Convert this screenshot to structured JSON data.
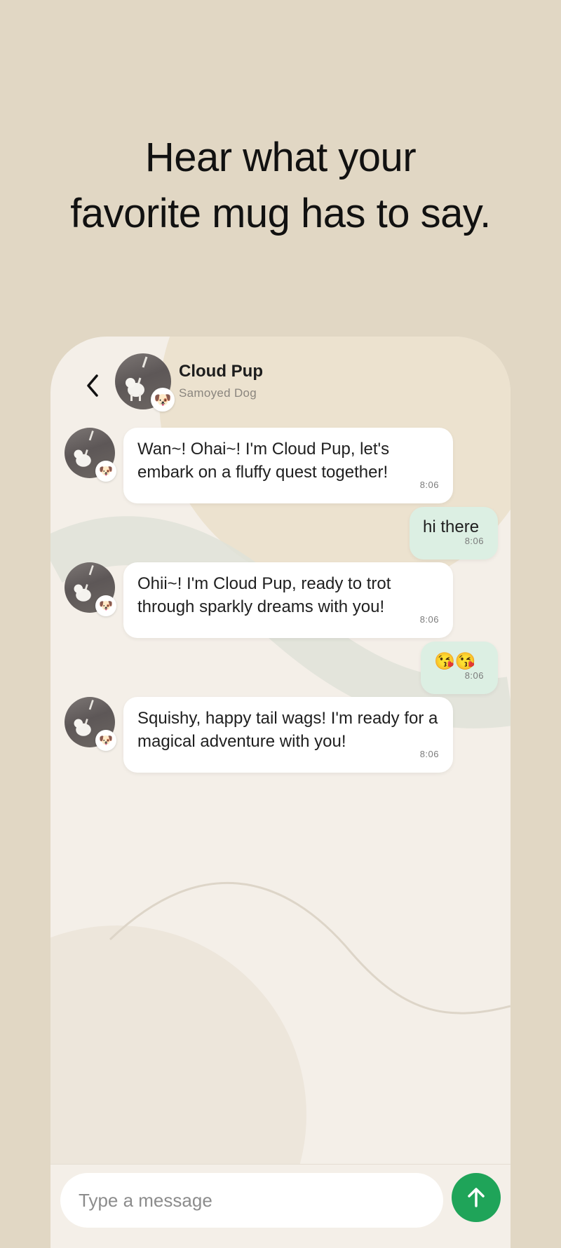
{
  "headline": {
    "line1": "Hear what your",
    "line2": "favorite mug has to say."
  },
  "header": {
    "name": "Cloud Pup",
    "subtitle": "Samoyed Dog"
  },
  "messages": [
    {
      "from": "bot",
      "text": "Wan~! Ohai~! I'm Cloud Pup, let's embark on a fluffy quest together!",
      "time": "8:06"
    },
    {
      "from": "user",
      "text": "hi there",
      "time": "8:06"
    },
    {
      "from": "bot",
      "text": "Ohii~! I'm Cloud Pup, ready to trot through sparkly dreams with you!",
      "time": "8:06"
    },
    {
      "from": "user",
      "text": "😘😘",
      "time": "8:06"
    },
    {
      "from": "bot",
      "text": "Squishy, happy tail wags! I'm ready for a magical adventure with you!",
      "time": "8:06"
    }
  ],
  "input": {
    "placeholder": "Type a message"
  },
  "icons": {
    "back": "chevron-left-icon",
    "send": "arrow-up-icon",
    "badge": "dog-face-emoji"
  },
  "colors": {
    "background": "#e1d7c4",
    "chat_bg": "#f4efe8",
    "user_bubble": "#dcefe3",
    "send_button": "#1fa459"
  }
}
